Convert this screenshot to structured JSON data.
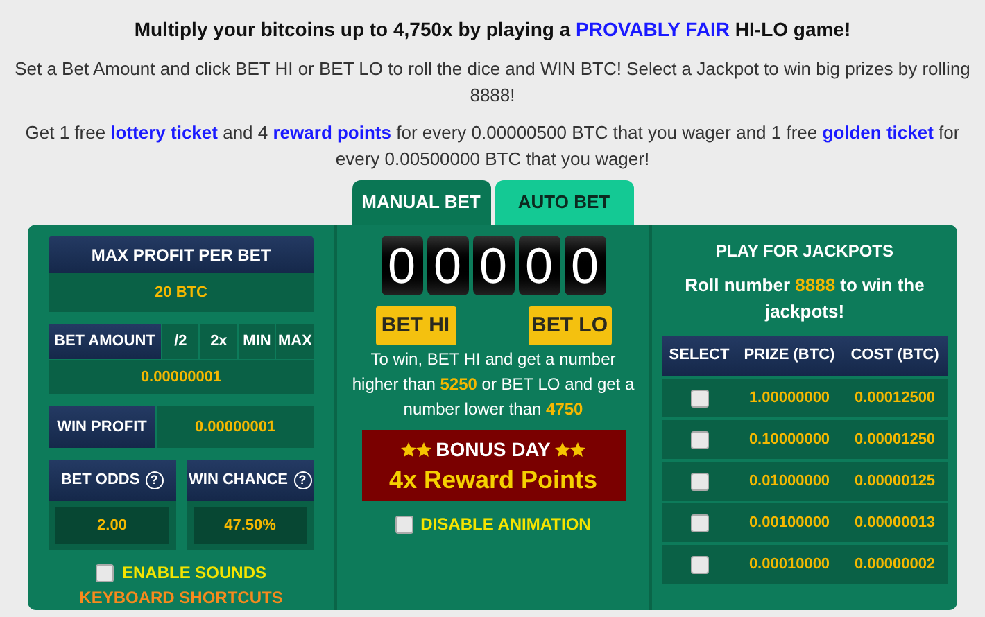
{
  "header": {
    "title": "Multiply your bitcoins up to 4,750x by playing a **PROVABLY FAIR** HI-LO game!",
    "lines": [
      "Set a Bet Amount and click BET HI or BET LO to roll the dice and WIN BTC! Select a Jackpot to win big prizes by rolling 8888!",
      "Get 1 free **lottery ticket** and 4 **reward points** for every 0.00000500 BTC that you wager and 1 free **golden ticket** for every 0.00500000 BTC that you wager!"
    ]
  },
  "tabs": [
    {
      "label": "MANUAL BET",
      "selected": true
    },
    {
      "label": "AUTO BET",
      "selected": false
    }
  ],
  "left": {
    "max_profit_label": "MAX PROFIT PER BET",
    "max_profit": "20 BTC",
    "bet_amount_label": "BET AMOUNT",
    "bet_amount_buttons": [
      "/2",
      "2x",
      "MIN",
      "MAX"
    ],
    "bet_amount": "0.00000001",
    "win_profit_label": "WIN PROFIT",
    "win_profit": "0.00000001",
    "bet_odds_label": "BET ODDS",
    "bet_odds": "2.00",
    "win_chance_label": "WIN CHANCE",
    "win_chance": "47.50%",
    "help_mark": "?",
    "enable_sounds": {
      "label": "ENABLE SOUNDS",
      "checked": false
    },
    "keyboard_shortcuts": "KEYBOARD SHORTCUTS"
  },
  "middle": {
    "digits": [
      "0",
      "0",
      "0",
      "0",
      "0"
    ],
    "bet_hi": "BET HI",
    "bet_lo": "BET LO",
    "rule": "To win, BET HI and get a number higher than **5250** or BET LO and get a number lower than **4750**",
    "bonus": {
      "title": "BONUS DAY",
      "text": "4x Reward Points"
    },
    "disable_animation": {
      "label": "DISABLE ANIMATION",
      "checked": false
    }
  },
  "jackpots": {
    "title": "PLAY FOR JACKPOTS",
    "subtitle": "Roll number **8888** to win the jackpots!",
    "columns": [
      "SELECT",
      "PRIZE (BTC)",
      "COST (BTC)"
    ],
    "rows": [
      {
        "checked": false,
        "prize": "1.00000000",
        "cost": "0.00012500"
      },
      {
        "checked": false,
        "prize": "0.10000000",
        "cost": "0.00001250"
      },
      {
        "checked": false,
        "prize": "0.01000000",
        "cost": "0.00000125"
      },
      {
        "checked": false,
        "prize": "0.00100000",
        "cost": "0.00000013"
      },
      {
        "checked": false,
        "prize": "0.00010000",
        "cost": "0.00000002"
      }
    ]
  }
}
